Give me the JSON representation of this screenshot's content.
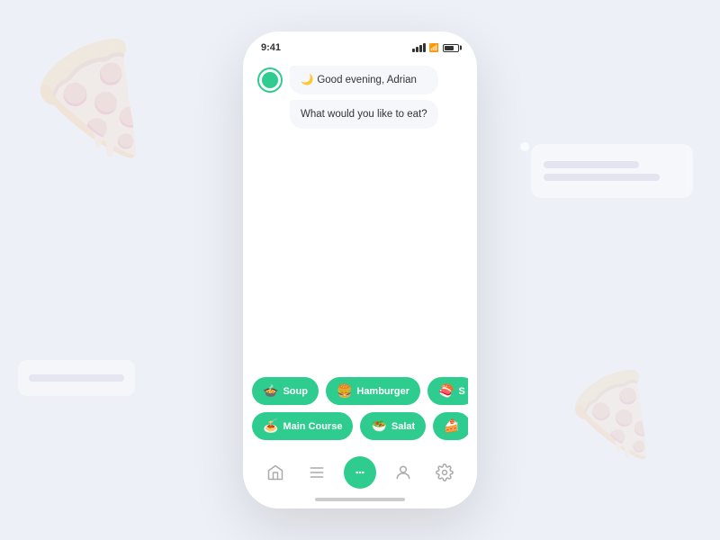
{
  "background": {
    "color": "#eef0f7"
  },
  "statusBar": {
    "time": "9:41",
    "signal": true,
    "wifi": true,
    "battery": true
  },
  "chat": {
    "greeting_emoji": "🌙",
    "greeting_text": "Good evening, Adrian",
    "question_text": "What would you like to eat?"
  },
  "quickReplies": {
    "row1": [
      {
        "emoji": "🍲",
        "label": "Soup"
      },
      {
        "emoji": "🍔",
        "label": "Hamburger"
      },
      {
        "emoji": "🍣",
        "label": "S..."
      }
    ],
    "row2": [
      {
        "emoji": "🍝",
        "label": "Main Course"
      },
      {
        "emoji": "🥗",
        "label": "Salat"
      },
      {
        "emoji": "🍰",
        "label": "..."
      }
    ]
  },
  "nav": {
    "items": [
      {
        "name": "home",
        "label": "Home",
        "icon": "home",
        "active": false
      },
      {
        "name": "menu",
        "label": "Menu",
        "icon": "menu",
        "active": false
      },
      {
        "name": "chat",
        "label": "Chat",
        "icon": "chat",
        "active": true
      },
      {
        "name": "profile",
        "label": "Profile",
        "icon": "user",
        "active": false
      },
      {
        "name": "settings",
        "label": "Settings",
        "icon": "settings",
        "active": false
      }
    ]
  }
}
